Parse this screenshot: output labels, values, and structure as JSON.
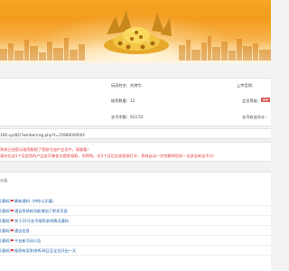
{
  "account": {
    "name_label": "玩家姓名：",
    "name_value": "刘港华",
    "upload_label": "上传音频：",
    "recommend_label": "推荐数量：",
    "recommend_value": "12",
    "member_label": "会员等级：",
    "member_badge": "VIP",
    "coin_label": "金币余额：",
    "coin_value": "923.55",
    "income_label": "金币收益合计："
  },
  "invite": {
    "link": "166.xyz82/?wmber/reg.php?t=15980000001"
  },
  "notice": {
    "line1": "系统已经提示限您解锁了您账号加产会员中，请查看！",
    "line2": "请勿在这1个月里您的产品金币被各位提前领取，所得到，在3个月后全部直接打开，系统自动一次性解除您的一全部全新金币与！"
  },
  "section": {
    "title": "公告"
  },
  "news": [
    {
      "category": "[通知]",
      "title": "最新通知（供你认识着）"
    },
    {
      "category": "[通知]",
      "title": "通告系统新功能增加了更多页面"
    },
    {
      "category": "[通知]",
      "title": "关于22号金币推荐游戏情况通知"
    },
    {
      "category": "[通知]",
      "title": "通告信息"
    },
    {
      "category": "[通知]",
      "title": "平台新活动公告"
    },
    {
      "category": "[通知]",
      "title": "推荐有奖系统将28日至全员开启一天"
    }
  ],
  "colors": {
    "accent": "#f39c1e",
    "link": "#1f5fa8",
    "alert": "#e4393c"
  }
}
